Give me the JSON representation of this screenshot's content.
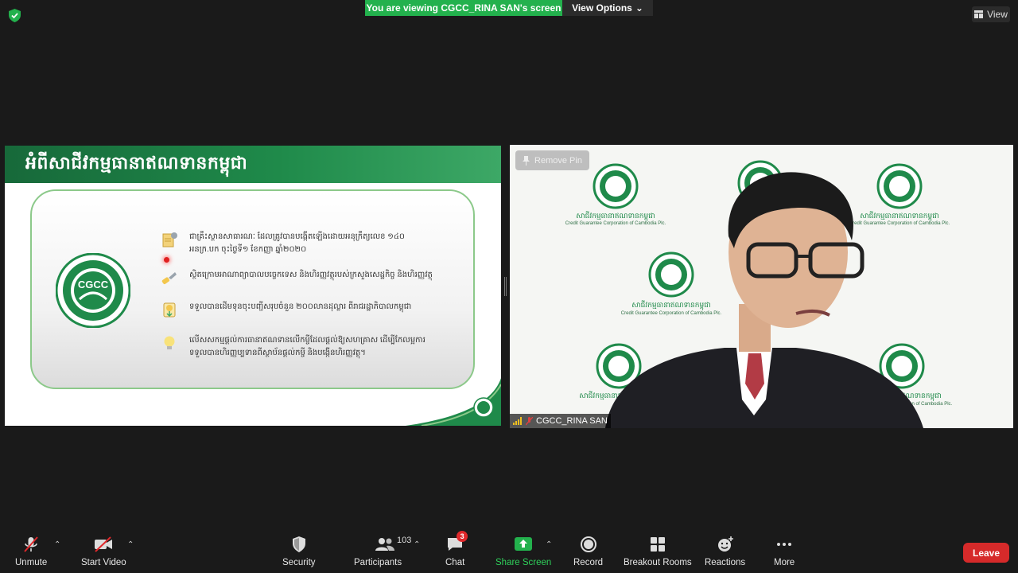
{
  "top_bar": {
    "banner_text": "You are viewing CGCC_RINA SAN's screen",
    "view_options_label": "View Options",
    "view_label": "View"
  },
  "slide": {
    "title": "អំពីសាជីវកម្មធានាឥណទានកម្ពុជា",
    "logo_text": "CGCC",
    "bullets": [
      {
        "icon": "document-gear-icon",
        "text": "ជាគ្រឹះស្ថានសាធារណៈ ដែលត្រូវបានបង្កើតឡើងដោយអនុក្រឹត្យលេខ ១៤០ អនក្រ.បក ចុះថ្ងៃទី១ ខែកញ្ញា ឆ្នាំ២០២០"
      },
      {
        "icon": "wrench-icon",
        "text": "ស្ថិតក្រោមអាណាព្យាបាលបច្ចេកទេស និងហិរញ្ញវត្ថុរបស់ក្រសួងសេដ្ឋកិច្ច និងហិរញ្ញវត្ថុ"
      },
      {
        "icon": "money-icon",
        "text": "ទទួលបានដើមទុនចុះបញ្ជីសរុបចំនួន ២០០លានដុល្លារ ពីរាជរដ្ឋាភិបាលកម្ពុជា"
      },
      {
        "icon": "lightbulb-icon",
        "text": "លើសសកម្មផ្តល់ការធានាឥណទានលើកម្ចីដែលផ្តល់ឱ្យសហគ្រាស ដើម្បីកែលម្អការទទួលបានហិរញ្ញប្បទានពីស្ថាប័នផ្តល់កម្ចី និងបង្កើនហិរញ្ញវត្ថុ។"
      }
    ]
  },
  "video": {
    "remove_pin_label": "Remove Pin",
    "participant_name": "CGCC_RINA SAN",
    "backdrop_khmer": "សាជីវកម្មធានាឥណទានកម្ពុជា",
    "backdrop_english": "Credit Guarantee Corporation of Cambodia Plc."
  },
  "toolbar": {
    "unmute": "Unmute",
    "start_video": "Start Video",
    "security": "Security",
    "participants": "Participants",
    "participants_count": "103",
    "chat": "Chat",
    "chat_badge": "3",
    "share_screen": "Share Screen",
    "record": "Record",
    "breakout_rooms": "Breakout Rooms",
    "reactions": "Reactions",
    "more": "More",
    "leave": "Leave"
  },
  "colors": {
    "banner_green": "#23b14d",
    "slide_green": "#1f8a4a",
    "leave_red": "#d62a2a",
    "share_green": "#23b14d"
  }
}
